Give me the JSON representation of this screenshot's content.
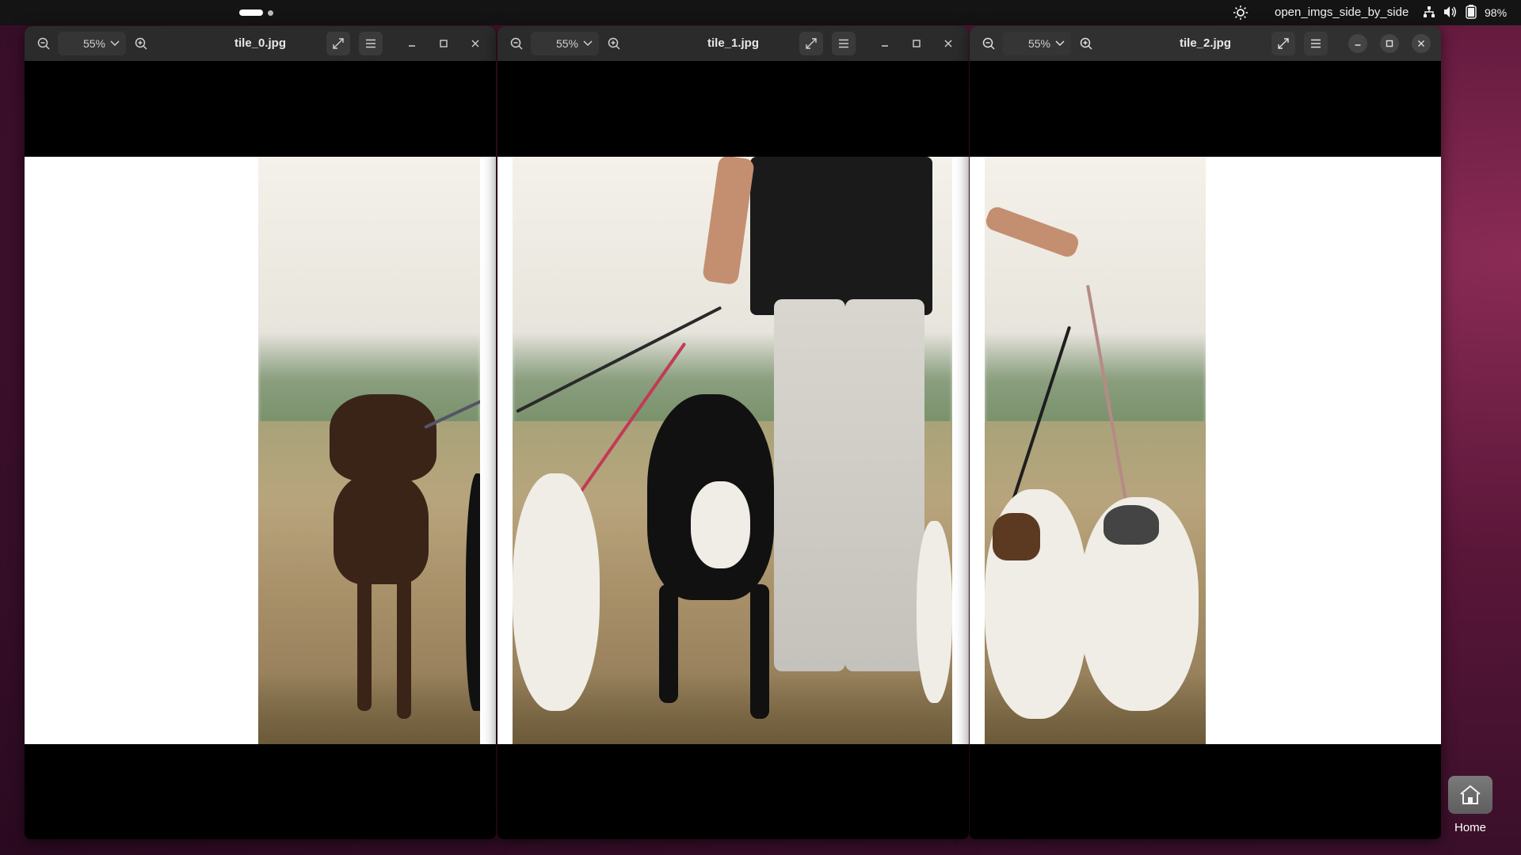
{
  "topbar": {
    "app_title": "open_imgs_side_by_side",
    "battery": "98%",
    "icons": [
      "brightness-icon",
      "network-icon",
      "volume-icon",
      "battery-icon"
    ]
  },
  "windows": [
    {
      "title": "tile_0.jpg",
      "zoom": "55%"
    },
    {
      "title": "tile_1.jpg",
      "zoom": "55%"
    },
    {
      "title": "tile_2.jpg",
      "zoom": "55%"
    }
  ],
  "desktop": {
    "home_label": "Home"
  },
  "colors": {
    "topbar_bg": "#141414",
    "headerbar_bg": "#2b2b2b",
    "desktop_accent": "#5a1638"
  }
}
